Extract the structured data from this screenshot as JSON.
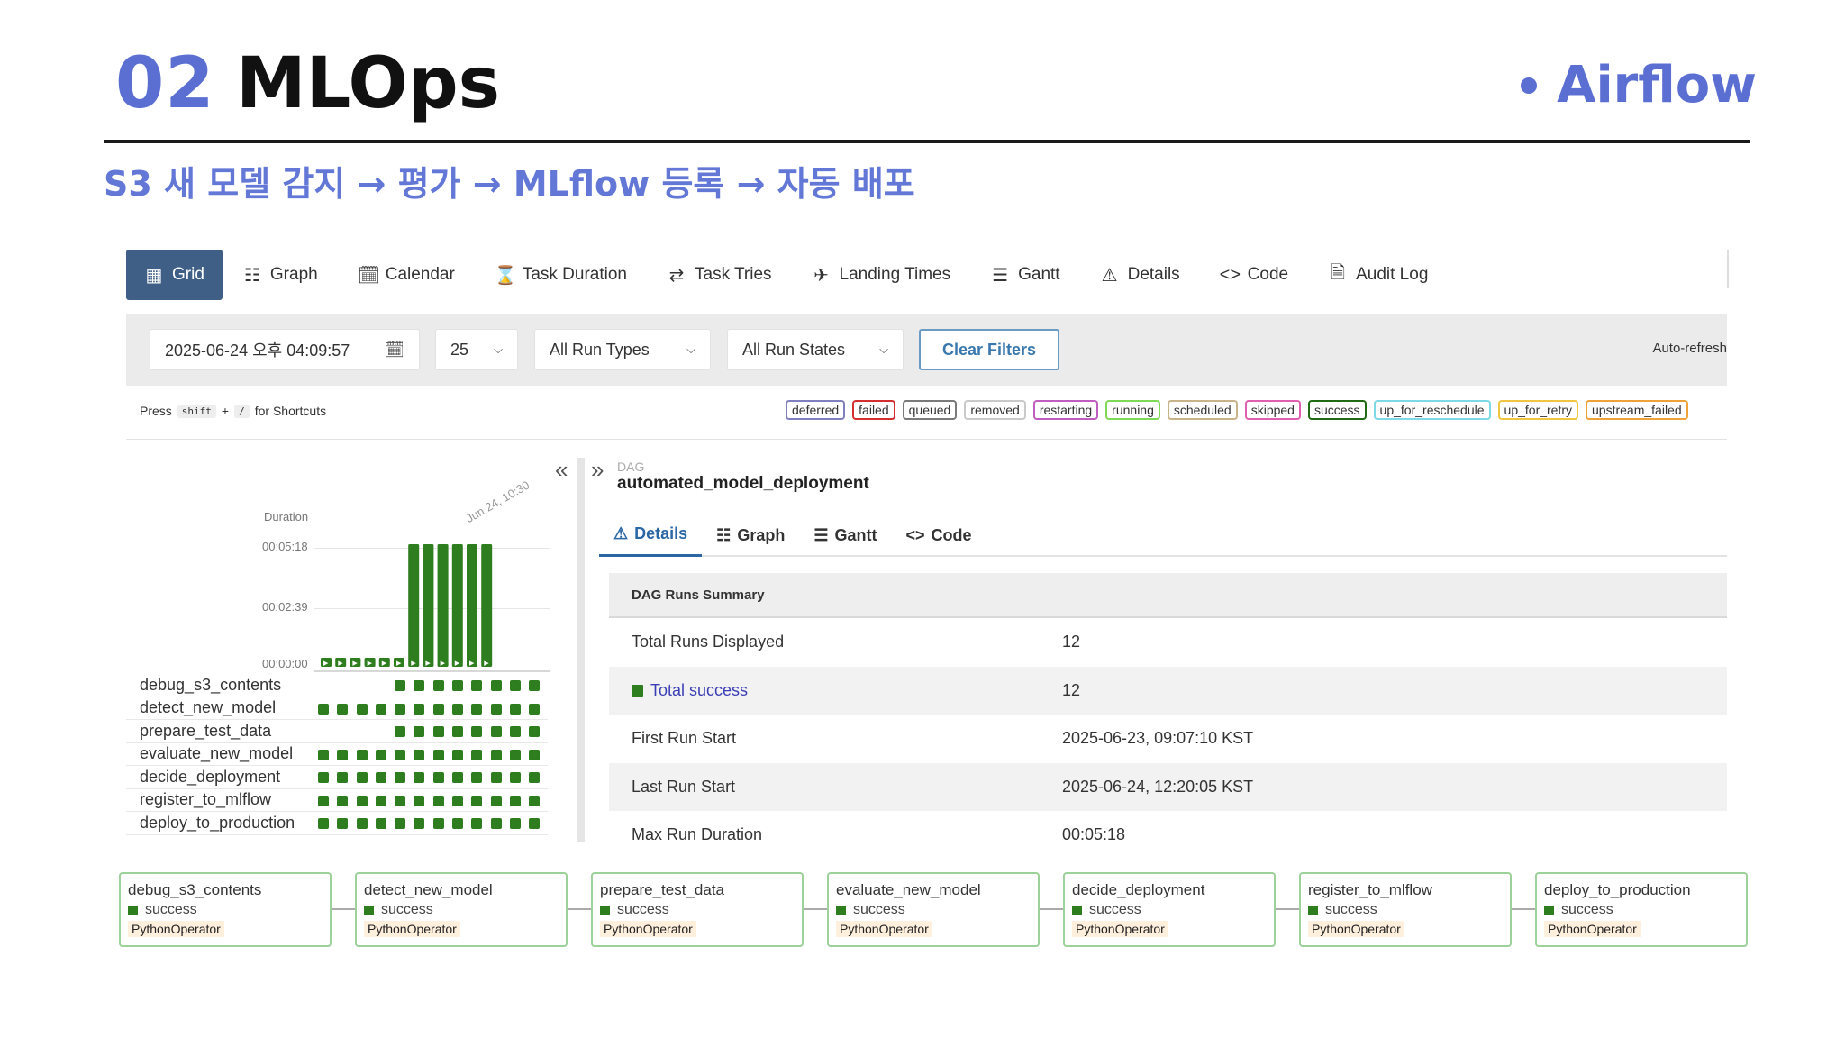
{
  "slide": {
    "number": "02",
    "title": "MLOps",
    "tag": "Airflow",
    "subtitle": "S3 새 모델 감지 → 평가 → MLflow 등록 → 자동 배포"
  },
  "colors": {
    "accent": "#5b6fd3",
    "success": "#2e7d1f",
    "active_tab": "#3f5f86"
  },
  "top_tabs": [
    {
      "label": "Grid",
      "icon": "grid-icon",
      "active": true
    },
    {
      "label": "Graph",
      "icon": "graph-icon"
    },
    {
      "label": "Calendar",
      "icon": "calendar-icon"
    },
    {
      "label": "Task Duration",
      "icon": "hourglass-icon"
    },
    {
      "label": "Task Tries",
      "icon": "repeat-icon"
    },
    {
      "label": "Landing Times",
      "icon": "landing-icon"
    },
    {
      "label": "Gantt",
      "icon": "gantt-icon"
    },
    {
      "label": "Details",
      "icon": "warning-icon"
    },
    {
      "label": "Code",
      "icon": "code-icon"
    },
    {
      "label": "Audit Log",
      "icon": "document-icon"
    }
  ],
  "filters": {
    "date": "2025-06-24 오후 04:09:57",
    "num_runs": "25",
    "run_types": "All Run Types",
    "run_states": "All Run States",
    "clear": "Clear Filters",
    "auto_refresh": "Auto-refresh"
  },
  "shortcut": {
    "press": "Press",
    "key1": "shift",
    "plus": "+",
    "key2": "/",
    "suffix": "for Shortcuts"
  },
  "states": [
    {
      "label": "deferred",
      "color": "#8080c0"
    },
    {
      "label": "failed",
      "color": "#d32f2f"
    },
    {
      "label": "queued",
      "color": "#7a7a7a"
    },
    {
      "label": "removed",
      "color": "#c9c9c9"
    },
    {
      "label": "restarting",
      "color": "#c05dc0"
    },
    {
      "label": "running",
      "color": "#7ed957"
    },
    {
      "label": "scheduled",
      "color": "#c9b38a"
    },
    {
      "label": "skipped",
      "color": "#e05fb0"
    },
    {
      "label": "success",
      "color": "#1f6b14"
    },
    {
      "label": "up_for_reschedule",
      "color": "#7fd8e6"
    },
    {
      "label": "up_for_retry",
      "color": "#f0c542"
    },
    {
      "label": "upstream_failed",
      "color": "#f0a23a"
    }
  ],
  "grid": {
    "duration_label": "Duration",
    "y_ticks": [
      "00:05:18",
      "00:02:39",
      "00:00:00"
    ],
    "date_mark": "Jun 24, 10:30",
    "run_durations_sec": [
      12,
      12,
      6,
      6,
      6,
      6,
      318,
      318,
      318,
      318,
      318,
      318
    ],
    "tasks": [
      {
        "name": "debug_s3_contents",
        "runs": [
          0,
          0,
          0,
          0,
          1,
          1,
          1,
          1,
          1,
          1,
          1,
          1
        ]
      },
      {
        "name": "detect_new_model",
        "runs": [
          1,
          1,
          1,
          1,
          1,
          1,
          1,
          1,
          1,
          1,
          1,
          1
        ]
      },
      {
        "name": "prepare_test_data",
        "runs": [
          0,
          0,
          0,
          0,
          1,
          1,
          1,
          1,
          1,
          1,
          1,
          1
        ]
      },
      {
        "name": "evaluate_new_model",
        "runs": [
          1,
          1,
          1,
          1,
          1,
          1,
          1,
          1,
          1,
          1,
          1,
          1
        ]
      },
      {
        "name": "decide_deployment",
        "runs": [
          1,
          1,
          1,
          1,
          1,
          1,
          1,
          1,
          1,
          1,
          1,
          1
        ]
      },
      {
        "name": "register_to_mlflow",
        "runs": [
          1,
          1,
          1,
          1,
          1,
          1,
          1,
          1,
          1,
          1,
          1,
          1
        ]
      },
      {
        "name": "deploy_to_production",
        "runs": [
          1,
          1,
          1,
          1,
          1,
          1,
          1,
          1,
          1,
          1,
          1,
          1
        ]
      }
    ]
  },
  "detail": {
    "dag_label": "DAG",
    "dag_id": "automated_model_deployment",
    "tabs": [
      {
        "label": "Details",
        "icon": "warning-icon",
        "active": true
      },
      {
        "label": "Graph",
        "icon": "graph-icon"
      },
      {
        "label": "Gantt",
        "icon": "gantt-icon"
      },
      {
        "label": "Code",
        "icon": "code-icon"
      }
    ],
    "summary_title": "DAG Runs Summary",
    "summary": [
      {
        "key": "Total Runs Displayed",
        "value": "12"
      },
      {
        "key": "Total success",
        "value": "12",
        "badge": true
      },
      {
        "key": "First Run Start",
        "value": "2025-06-23, 09:07:10 KST"
      },
      {
        "key": "Last Run Start",
        "value": "2025-06-24, 12:20:05 KST"
      },
      {
        "key": "Max Run Duration",
        "value": "00:05:18"
      }
    ]
  },
  "pipeline": [
    {
      "name": "debug_s3_contents",
      "status": "success",
      "operator": "PythonOperator"
    },
    {
      "name": "detect_new_model",
      "status": "success",
      "operator": "PythonOperator"
    },
    {
      "name": "prepare_test_data",
      "status": "success",
      "operator": "PythonOperator"
    },
    {
      "name": "evaluate_new_model",
      "status": "success",
      "operator": "PythonOperator"
    },
    {
      "name": "decide_deployment",
      "status": "success",
      "operator": "PythonOperator"
    },
    {
      "name": "register_to_mlflow",
      "status": "success",
      "operator": "PythonOperator"
    },
    {
      "name": "deploy_to_production",
      "status": "success",
      "operator": "PythonOperator"
    }
  ]
}
